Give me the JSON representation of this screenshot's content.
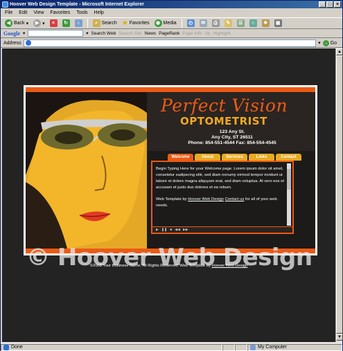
{
  "window": {
    "title": "Hoover Web Design Template - Microsoft Internet Explorer",
    "buttons": [
      "_",
      "□",
      "×"
    ]
  },
  "menu": [
    "File",
    "Edit",
    "View",
    "Favorites",
    "Tools",
    "Help"
  ],
  "toolbar": {
    "back": "Back",
    "search": "Search",
    "favorites": "Favorites",
    "media": "Media"
  },
  "googlebar": {
    "logo": "Google",
    "search_web": "Search Web",
    "search_site": "Search Site",
    "news": "News",
    "pagerank": "PageRank",
    "page_info": "Page Info",
    "up": "Up",
    "highlight": "Highlight"
  },
  "address": {
    "label": "Address",
    "value": "",
    "go": "Go"
  },
  "site": {
    "title": "Perfect Vision",
    "subtitle": "OPTOMETRIST",
    "street": "123 Any St.",
    "city": "Any City, ST 26511",
    "phone": "Phone: 854-551-4544 Fax: 854-554-4545",
    "tabs": [
      "Welcome",
      "About",
      "Services",
      "Links",
      "Contact"
    ],
    "content_p1": "Begin Typing Here for your Welcome page. Lorem ipsum dolor sit amet, consetetur sadipscing elitr, sed diam nonumy eirmod tempor invidunt ut labore et dolore magna aliquyam erat, sed diam voluptua. At vero eos et accusam et justo duo dolores et ea rebum.",
    "content_p2_a": "Web Template by ",
    "content_p2_link1": "Hoover Web Design",
    "content_p2_b": " ",
    "content_p2_link2": "Contact us",
    "content_p2_c": " for all of your web needs.",
    "watermark": "© Hoover Web Design",
    "footer_text": "©2003 Your Business Name. All Rights Reserved. Web Template by ",
    "footer_link": "Hoover Web Design"
  },
  "status": {
    "text": "Done",
    "zone": "My Computer"
  },
  "colors": {
    "accent_orange": "#ea5a15",
    "accent_gold": "#e7aa22",
    "page_bg": "#232323"
  }
}
